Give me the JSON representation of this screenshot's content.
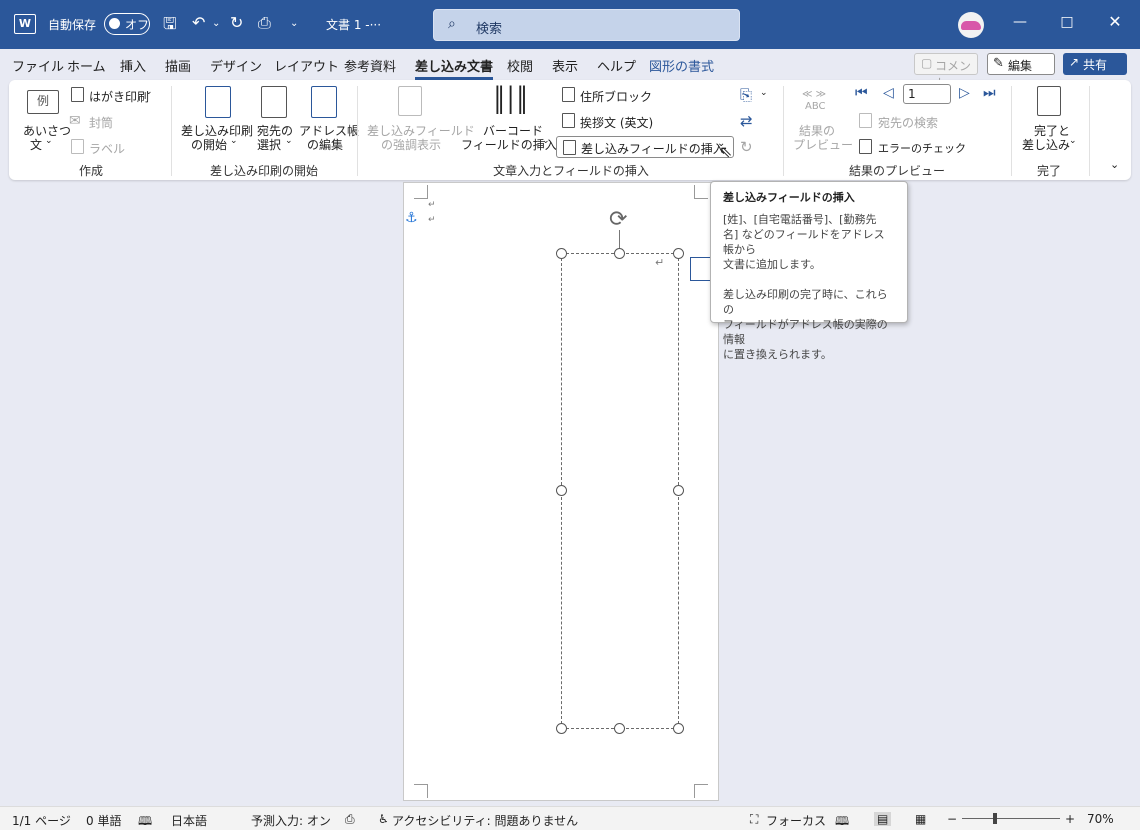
{
  "titlebar": {
    "autosave_label": "自動保存",
    "autosave_state": "オフ",
    "doc_title": "文書 1  -···",
    "search_placeholder": "検索"
  },
  "tabs": [
    "ファイル",
    "ホーム",
    "挿入",
    "描画",
    "デザイン",
    "レイアウト",
    "参考資料",
    "差し込み文書",
    "校閲",
    "表示",
    "ヘルプ",
    "図形の書式"
  ],
  "tab_active": "差し込み文書",
  "tab_buttons": {
    "comment": "コメント",
    "edit": "編集",
    "share": "共有"
  },
  "ribbon": {
    "create": {
      "label": "作成",
      "greeting_line1": "あいさつ",
      "greeting_line2": "文",
      "greeting_icon_text": "例",
      "postcard": "はがき印刷",
      "envelope": "封筒",
      "labels": "ラベル"
    },
    "start_merge": {
      "label": "差し込み印刷の開始",
      "start_line1": "差し込み印刷",
      "start_line2": "の開始",
      "select_line1": "宛先の",
      "select_line2": "選択",
      "edit_line1": "アドレス帳",
      "edit_line2": "の編集"
    },
    "write_insert": {
      "label": "文章入力とフィールドの挿入",
      "highlight_line1": "差し込みフィールド",
      "highlight_line2": "の強調表示",
      "barcode_line1": "バーコード",
      "barcode_line2": "フィールドの挿入",
      "address_block": "住所ブロック",
      "greeting_line": "挨拶文 (英文)",
      "insert_field": "差し込みフィールドの挿入"
    },
    "preview": {
      "label": "結果のプレビュー",
      "preview_line1": "結果の",
      "preview_line2": "プレビュー",
      "abc_top": "≪ ≫",
      "abc": "ABC",
      "record": "1",
      "find_recipient": "宛先の検索",
      "check_errors": "エラーのチェック"
    },
    "finish": {
      "label": "完了",
      "finish_line1": "完了と",
      "finish_line2": "差し込み"
    }
  },
  "tooltip": {
    "title": "差し込みフィールドの挿入",
    "para1_line1": "[姓]、[自宅電話番号]、[勤務先",
    "para1_line2": "名] などのフィールドをアドレス帳から",
    "para1_line3": "文書に追加します。",
    "para2_line1": "差し込み印刷の完了時に、これらの",
    "para2_line2": "フィールドがアドレス帳の実際の情報",
    "para2_line3": "に置き換えられます。"
  },
  "statusbar": {
    "page": "1/1 ページ",
    "words": "0 単語",
    "language": "日本語",
    "predictive": "予測入力: オン",
    "accessibility": "アクセシビリティ: 問題ありません",
    "focus": "フォーカス",
    "zoom": "70%",
    "zoom_minus": "−",
    "zoom_plus": "+"
  },
  "colors": {
    "accent": "#2b579a",
    "tooltip_border": "#b3b3b3",
    "disabled": "#a6a6a6"
  },
  "icons": [
    "word-logo-icon",
    "save-icon",
    "undo-icon",
    "redo-icon",
    "print-preview-icon",
    "search-icon",
    "minimize-icon",
    "maximize-icon",
    "close-icon",
    "anchor-icon",
    "rotate-icon",
    "layout-options-icon"
  ]
}
